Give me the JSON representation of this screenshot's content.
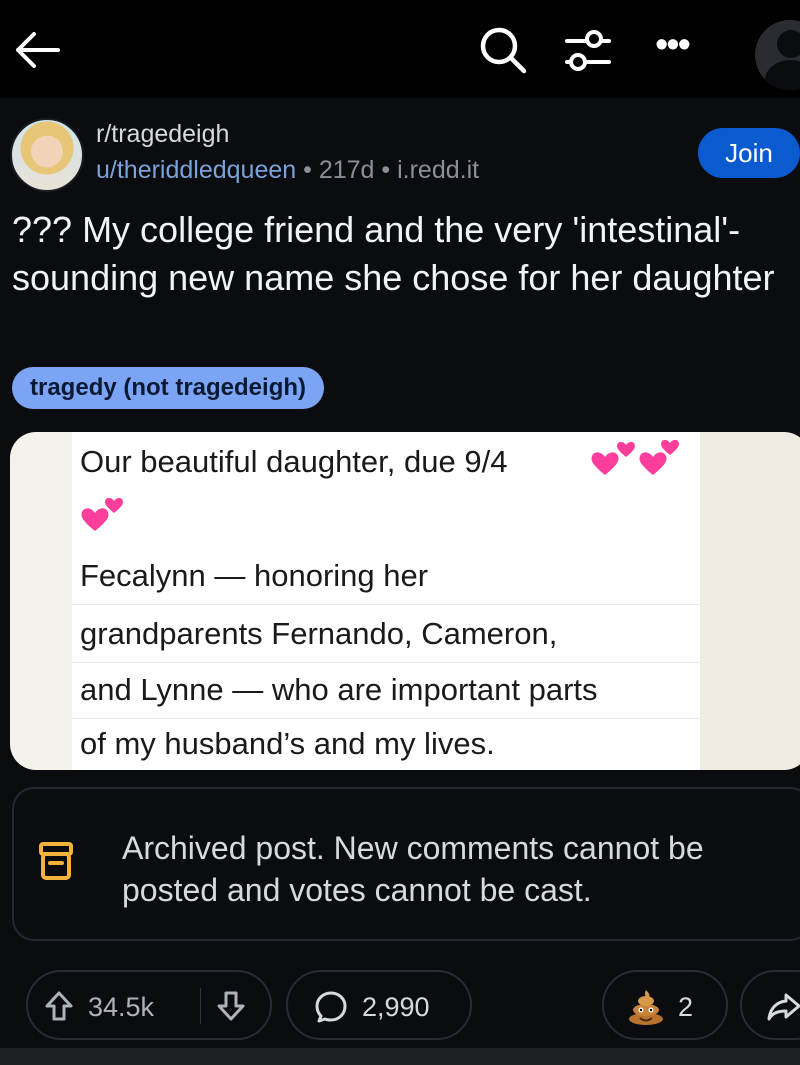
{
  "post": {
    "subreddit": "r/tragedeigh",
    "author": "u/theriddledqueen",
    "age": "217d",
    "domain": "i.redd.it",
    "join_label": "Join",
    "title": "??? My college friend and the very 'intestinal'-sounding new name she chose for her daughter",
    "flair": "tragedy (not tragedeigh)"
  },
  "image": {
    "line1": "Our beautiful daughter, due 9/4",
    "line2": "Fecalynn — honoring her",
    "line3": "grandparents Fernando, Cameron,",
    "line4": "and Lynne — who are important parts",
    "line5": "of my husband’s and my lives."
  },
  "archive": {
    "message": "Archived post. New comments cannot be posted and votes cannot be cast."
  },
  "actions": {
    "upvotes": "34.5k",
    "comments": "2,990",
    "awards": "2"
  },
  "colors": {
    "join": "#0b5bd0",
    "flair": "#7ba4f5",
    "background": "#0b0c0f",
    "hearts": "#ff3d9a"
  }
}
